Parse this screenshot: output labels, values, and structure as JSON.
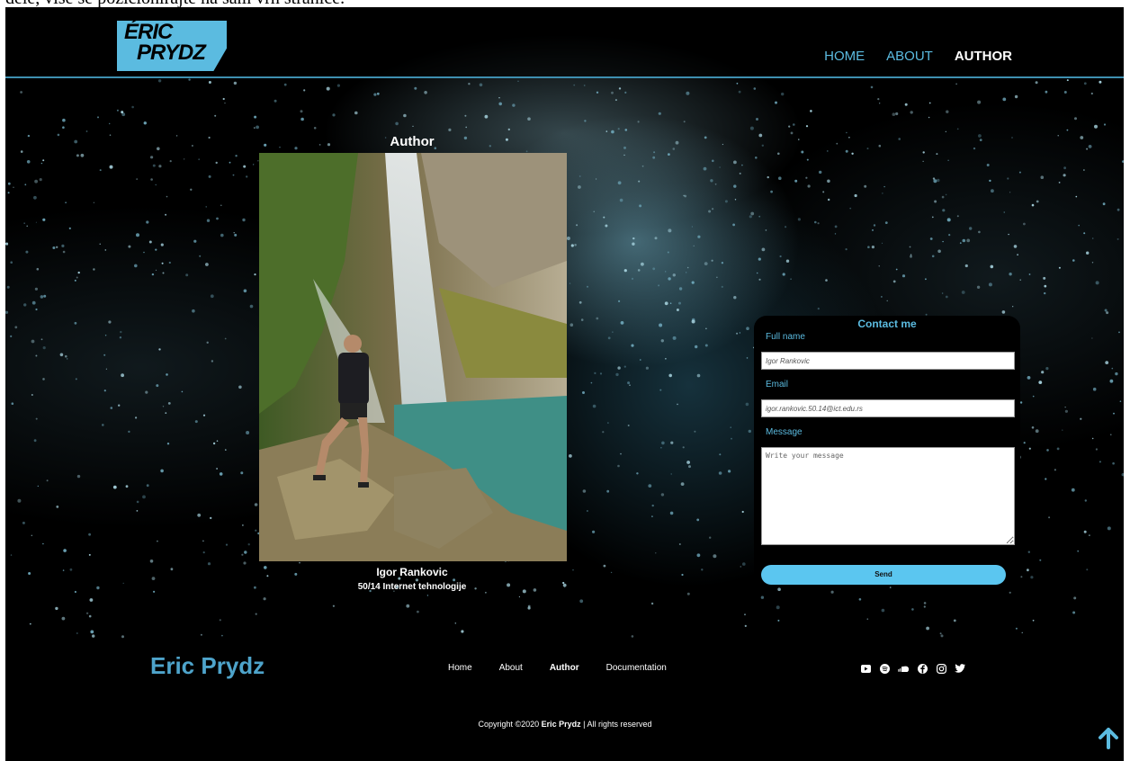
{
  "doc_text": "dele, više se pozicionirajte na sam vrh stranice.",
  "logo": {
    "line1": "ÉRIC",
    "line2": "PRYDZ",
    "color": "#5bbbe0"
  },
  "nav": {
    "items": [
      {
        "label": "HOME",
        "active": false
      },
      {
        "label": "ABOUT",
        "active": false
      },
      {
        "label": "AUTHOR",
        "active": true
      }
    ]
  },
  "author": {
    "heading": "Author",
    "name": "Igor Rankovic",
    "index": "50/14 Internet tehnologije"
  },
  "contact": {
    "title": "Contact me",
    "full_name_label": "Full name",
    "full_name_placeholder": "Igor Rankovic",
    "email_label": "Email",
    "email_placeholder": "igor.rankovic.50.14@ict.edu.rs",
    "message_label": "Message",
    "message_placeholder": "Write your message",
    "send_label": "Send"
  },
  "footer": {
    "brand": "Eric Prydz",
    "links": [
      {
        "label": "Home",
        "active": false
      },
      {
        "label": "About",
        "active": false
      },
      {
        "label": "Author",
        "active": true
      },
      {
        "label": "Documentation",
        "active": false
      }
    ],
    "socials": [
      "youtube-icon",
      "spotify-icon",
      "soundcloud-icon",
      "facebook-icon",
      "instagram-icon",
      "twitter-icon"
    ],
    "copyright_prefix": "Copyright ©2020 ",
    "copyright_brand": "Eric Prydz",
    "copyright_suffix": " | All rights reserved"
  },
  "colors": {
    "accent": "#5bbbe0",
    "button": "#5bc6f0",
    "background": "#000000"
  }
}
